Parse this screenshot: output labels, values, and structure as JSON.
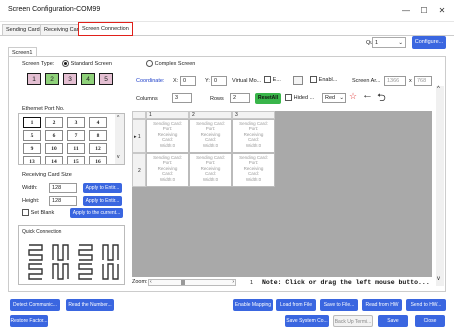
{
  "window": {
    "title": "Screen Configuration-COM99",
    "minimize": "—",
    "maximize": "☐",
    "close": "✕"
  },
  "tabs": [
    {
      "label": "Sending Card"
    },
    {
      "label": "Receiving Card"
    },
    {
      "label": "Screen Connection"
    }
  ],
  "quantity": {
    "label": "Quantity o...",
    "value": "1"
  },
  "configure_label": "Configure...",
  "subtab": "Screen1",
  "screen_type": {
    "label": "Screen Type:",
    "standard": "Standard Screen",
    "complex": "Complex Screen"
  },
  "type_boxes": [
    "1",
    "2",
    "3",
    "4",
    "5"
  ],
  "coord": {
    "label": "Coordinate:",
    "x_label": "X:",
    "x_value": "0",
    "y_label": "Y:",
    "y_value": "0",
    "virtual": "Virtual Mo...",
    "e_label": "E...",
    "enable": "Enabl...",
    "screen_area": "Screen Ar...",
    "w": "1366",
    "times": "x",
    "h": "768"
  },
  "columns": {
    "label": "Columns",
    "value": "3"
  },
  "rows": {
    "label": "Rows",
    "value": "2"
  },
  "reset_all": "ResetAll",
  "hided": "Hided ...",
  "color_select": "Red",
  "ethernet": {
    "label": "Ethernet Port No.",
    "ports": [
      "1",
      "2",
      "3",
      "4",
      "5",
      "6",
      "7",
      "8",
      "9",
      "10",
      "11",
      "12",
      "13",
      "14",
      "15",
      "16"
    ]
  },
  "recv_size": {
    "label": "Receiving Card Size",
    "width_label": "Width:",
    "width_value": "128",
    "height_label": "Height:",
    "height_value": "128",
    "apply_entire_1": "Apply to Entir...",
    "apply_entire_2": "Apply to Entir...",
    "set_blank": "Set Blank",
    "apply_current": "Apply to the current..."
  },
  "quick_connection": "Quick Connection",
  "grid": {
    "col_headers": [
      "1",
      "2",
      "3"
    ],
    "row_headers": [
      "1",
      "2"
    ],
    "cell_lines": [
      "Sending Card:",
      "Port:",
      "Receiving",
      "Card:",
      "Width:0"
    ]
  },
  "zoom": {
    "label": "Zoom:",
    "value": "1"
  },
  "note": "Note: Click or drag the left mouse butto...",
  "bottom": {
    "detect": "Detect Communic...",
    "read_number": "Read the Number...",
    "enable_mapping": "Enable Mapping",
    "load_file": "Load from File",
    "save_file": "Save to File...",
    "read_hw": "Read from HW",
    "send_hw": "Send to HW...",
    "restore": "Restore Factor...",
    "save_system": "Save System Co...",
    "back_up": "Back Up Termi...",
    "save": "Save",
    "close": "Close"
  }
}
